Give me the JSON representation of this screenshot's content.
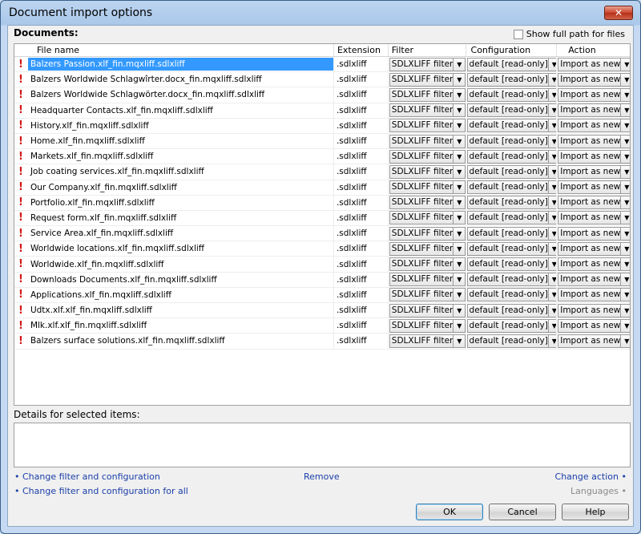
{
  "window": {
    "title": "Document import options",
    "close_glyph": "✕"
  },
  "documents": {
    "label": "Documents:",
    "show_full_path_label": "Show full path for files",
    "columns": {
      "name": "File name",
      "extension": "Extension",
      "filter": "Filter",
      "configuration": "Configuration",
      "action": "Action"
    },
    "rows": [
      {
        "name": "Balzers Passion.xlf_fin.mqxliff.sdlxliff",
        "ext": ".sdlxliff",
        "filter": "SDLXLIFF filter",
        "config": "default [read-only]",
        "action": "Import as new",
        "selected": true
      },
      {
        "name": "Balzers Worldwide Schlagwîrter.docx_fin.mqxliff.sdlxliff",
        "ext": ".sdlxliff",
        "filter": "SDLXLIFF filter",
        "config": "default [read-only]",
        "action": "Import as new"
      },
      {
        "name": "Balzers Worldwide Schlagwörter.docx_fin.mqxliff.sdlxliff",
        "ext": ".sdlxliff",
        "filter": "SDLXLIFF filter",
        "config": "default [read-only]",
        "action": "Import as new"
      },
      {
        "name": "Headquarter Contacts.xlf_fin.mqxliff.sdlxliff",
        "ext": ".sdlxliff",
        "filter": "SDLXLIFF filter",
        "config": "default [read-only]",
        "action": "Import as new"
      },
      {
        "name": "History.xlf_fin.mqxliff.sdlxliff",
        "ext": ".sdlxliff",
        "filter": "SDLXLIFF filter",
        "config": "default [read-only]",
        "action": "Import as new"
      },
      {
        "name": "Home.xlf_fin.mqxliff.sdlxliff",
        "ext": ".sdlxliff",
        "filter": "SDLXLIFF filter",
        "config": "default [read-only]",
        "action": "Import as new"
      },
      {
        "name": "Markets.xlf_fin.mqxliff.sdlxliff",
        "ext": ".sdlxliff",
        "filter": "SDLXLIFF filter",
        "config": "default [read-only]",
        "action": "Import as new"
      },
      {
        "name": "Job coating services.xlf_fin.mqxliff.sdlxliff",
        "ext": ".sdlxliff",
        "filter": "SDLXLIFF filter",
        "config": "default [read-only]",
        "action": "Import as new"
      },
      {
        "name": "Our Company.xlf_fin.mqxliff.sdlxliff",
        "ext": ".sdlxliff",
        "filter": "SDLXLIFF filter",
        "config": "default [read-only]",
        "action": "Import as new"
      },
      {
        "name": "Portfolio.xlf_fin.mqxliff.sdlxliff",
        "ext": ".sdlxliff",
        "filter": "SDLXLIFF filter",
        "config": "default [read-only]",
        "action": "Import as new"
      },
      {
        "name": "Request form.xlf_fin.mqxliff.sdlxliff",
        "ext": ".sdlxliff",
        "filter": "SDLXLIFF filter",
        "config": "default [read-only]",
        "action": "Import as new"
      },
      {
        "name": "Service Area.xlf_fin.mqxliff.sdlxliff",
        "ext": ".sdlxliff",
        "filter": "SDLXLIFF filter",
        "config": "default [read-only]",
        "action": "Import as new"
      },
      {
        "name": "Worldwide locations.xlf_fin.mqxliff.sdlxliff",
        "ext": ".sdlxliff",
        "filter": "SDLXLIFF filter",
        "config": "default [read-only]",
        "action": "Import as new"
      },
      {
        "name": "Worldwide.xlf_fin.mqxliff.sdlxliff",
        "ext": ".sdlxliff",
        "filter": "SDLXLIFF filter",
        "config": "default [read-only]",
        "action": "Import as new"
      },
      {
        "name": "Downloads Documents.xlf_fin.mqxliff.sdlxliff",
        "ext": ".sdlxliff",
        "filter": "SDLXLIFF filter",
        "config": "default [read-only]",
        "action": "Import as new"
      },
      {
        "name": "Applications.xlf_fin.mqxliff.sdlxliff",
        "ext": ".sdlxliff",
        "filter": "SDLXLIFF filter",
        "config": "default [read-only]",
        "action": "Import as new"
      },
      {
        "name": "Udtx.xlf.xlf_fin.mqxliff.sdlxliff",
        "ext": ".sdlxliff",
        "filter": "SDLXLIFF filter",
        "config": "default [read-only]",
        "action": "Import as new"
      },
      {
        "name": "Mlk.xlf.xlf_fin.mqxliff.sdlxliff",
        "ext": ".sdlxliff",
        "filter": "SDLXLIFF filter",
        "config": "default [read-only]",
        "action": "Import as new"
      },
      {
        "name": "Balzers surface solutions.xlf_fin.mqxliff.sdlxliff",
        "ext": ".sdlxliff",
        "filter": "SDLXLIFF filter",
        "config": "default [read-only]",
        "action": "Import as new"
      }
    ]
  },
  "details": {
    "label": "Details for selected items:"
  },
  "links": {
    "change_filter": "• Change filter and configuration",
    "change_filter_all": "• Change filter and configuration for all",
    "remove": "Remove",
    "change_action": "Change action •",
    "languages": "Languages •"
  },
  "buttons": {
    "ok": "OK",
    "cancel": "Cancel",
    "help": "Help"
  },
  "icons": {
    "warning": "!",
    "dropdown": "▼"
  },
  "colors": {
    "selection": "#3399ff",
    "warning": "#d21919",
    "link": "#1a3fa8"
  }
}
